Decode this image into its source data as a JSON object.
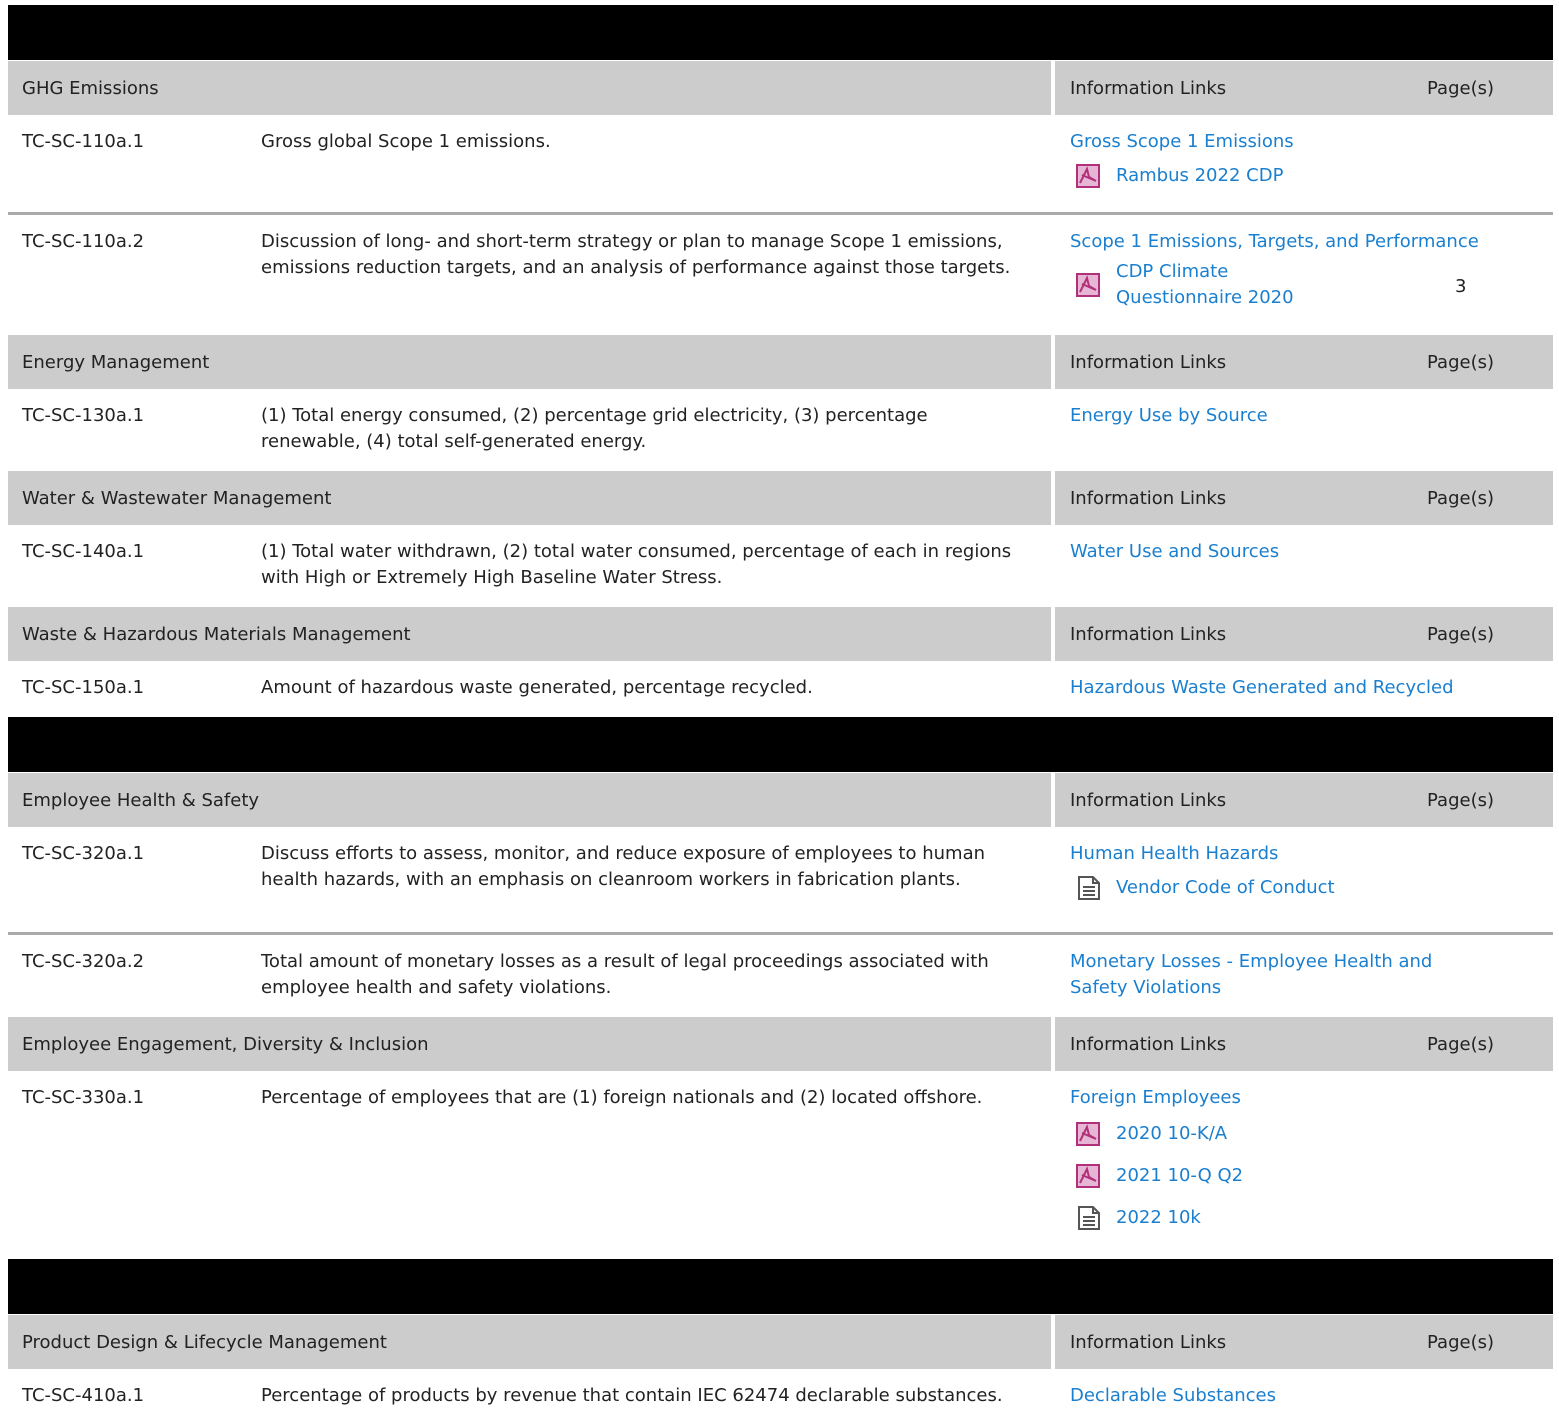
{
  "header_labels": {
    "information_links": "Information Links",
    "pages": "Page(s)"
  },
  "sections": [
    {
      "topics": [
        {
          "title": "GHG Emissions",
          "rows": [
            {
              "code": "TC-SC-110a.1",
              "description": "Gross global Scope 1 emissions.",
              "link": "Gross Scope 1 Emissions",
              "documents": [
                {
                  "icon": "pdf-icon",
                  "label": "Rambus 2022 CDP"
                }
              ],
              "page": ""
            },
            {
              "code": "TC-SC-110a.2",
              "description": "Discussion of long- and short-term strategy or plan to manage Scope 1 emissions, emissions reduction targets, and an analysis of performance against those targets.",
              "link": "Scope 1 Emissions, Targets, and Performance",
              "documents": [
                {
                  "icon": "pdf-icon",
                  "label": "CDP Climate Questionnaire 2020"
                }
              ],
              "page": "3"
            }
          ]
        },
        {
          "title": "Energy Management",
          "rows": [
            {
              "code": "TC-SC-130a.1",
              "description": "(1) Total energy consumed, (2) percentage grid electricity, (3) percentage renewable, (4) total self-generated energy.",
              "link": "Energy Use by Source",
              "documents": [],
              "page": ""
            }
          ]
        },
        {
          "title": "Water & Wastewater Management",
          "rows": [
            {
              "code": "TC-SC-140a.1",
              "description": "(1) Total water withdrawn, (2) total water consumed, percentage of each in regions with High or Extremely High Baseline Water Stress.",
              "link": "Water Use and Sources",
              "documents": [],
              "page": ""
            }
          ]
        },
        {
          "title": "Waste & Hazardous Materials Management",
          "rows": [
            {
              "code": "TC-SC-150a.1",
              "description": "Amount of hazardous waste generated, percentage recycled.",
              "link": "Hazardous Waste Generated and Recycled",
              "documents": [],
              "page": ""
            }
          ]
        }
      ]
    },
    {
      "topics": [
        {
          "title": "Employee Health & Safety",
          "rows": [
            {
              "code": "TC-SC-320a.1",
              "description": "Discuss efforts to assess, monitor, and reduce exposure of employees to human health hazards, with an emphasis on cleanroom workers in fabrication plants.",
              "link": "Human Health Hazards",
              "documents": [
                {
                  "icon": "document-icon",
                  "label": "Vendor Code of Conduct"
                }
              ],
              "page": ""
            },
            {
              "code": "TC-SC-320a.2",
              "description": "Total amount of monetary losses as a result of legal proceedings associated with employee health and safety violations.",
              "link": "Monetary Losses - Employee Health and Safety Violations",
              "documents": [],
              "page": ""
            }
          ]
        },
        {
          "title": "Employee Engagement, Diversity & Inclusion",
          "rows": [
            {
              "code": "TC-SC-330a.1",
              "description": "Percentage of employees that are (1) foreign nationals and (2) located offshore.",
              "link": "Foreign Employees",
              "documents": [
                {
                  "icon": "pdf-icon",
                  "label": "2020 10-K/A"
                },
                {
                  "icon": "pdf-icon",
                  "label": "2021 10-Q Q2"
                },
                {
                  "icon": "document-icon",
                  "label": "2022 10k"
                }
              ],
              "page": ""
            }
          ]
        }
      ]
    },
    {
      "topics": [
        {
          "title": "Product Design & Lifecycle Management",
          "rows": [
            {
              "code": "TC-SC-410a.1",
              "description": "Percentage of products by revenue that contain IEC 62474 declarable substances.",
              "link": "Declarable Substances",
              "documents": [],
              "page": ""
            }
          ]
        }
      ]
    }
  ]
}
